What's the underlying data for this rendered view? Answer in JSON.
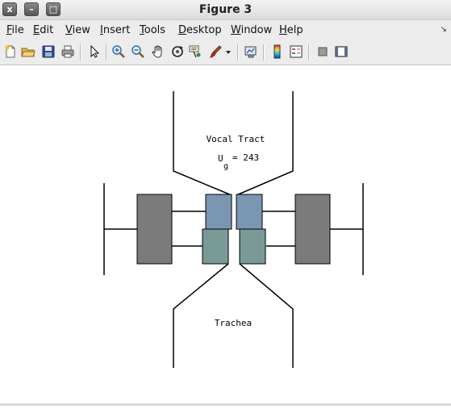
{
  "window": {
    "title": "Figure 3",
    "buttons": {
      "close": "x",
      "minimize": "–",
      "maximize": "□"
    }
  },
  "menubar": {
    "items": [
      {
        "label": "File",
        "mnemonic": "F",
        "rest": "ile"
      },
      {
        "label": "Edit",
        "mnemonic": "E",
        "rest": "dit"
      },
      {
        "label": "View",
        "mnemonic": "V",
        "rest": "iew"
      },
      {
        "label": "Insert",
        "mnemonic": "I",
        "rest": "nsert"
      },
      {
        "label": "Tools",
        "mnemonic": "T",
        "rest": "ools"
      },
      {
        "label": "Desktop",
        "mnemonic": "D",
        "rest": "esktop"
      },
      {
        "label": "Window",
        "mnemonic": "W",
        "rest": "indow"
      },
      {
        "label": "Help",
        "mnemonic": "H",
        "rest": "elp"
      }
    ],
    "dock_glyph": "↘"
  },
  "toolbar": {
    "icons": [
      "new-figure-icon",
      "open-file-icon",
      "save-icon",
      "print-icon",
      "edit-plot-arrow-icon",
      "zoom-in-icon",
      "zoom-out-icon",
      "pan-hand-icon",
      "rotate-3d-icon",
      "data-cursor-icon",
      "brush-icon",
      "brush-dropdown-icon",
      "link-plot-icon",
      "colorbar-icon",
      "legend-icon",
      "hide-plot-tools-icon",
      "show-plot-tools-icon"
    ]
  },
  "figure": {
    "label_top": "Vocal Tract",
    "flow_symbol": "U",
    "flow_subscript": "g",
    "flow_value": "= 243",
    "label_bottom": "Trachea",
    "colors": {
      "outer_mass": "#7b7b7b",
      "upper_fold": "#7b96b3",
      "lower_fold": "#7a9a97",
      "lines": "#000000"
    }
  }
}
